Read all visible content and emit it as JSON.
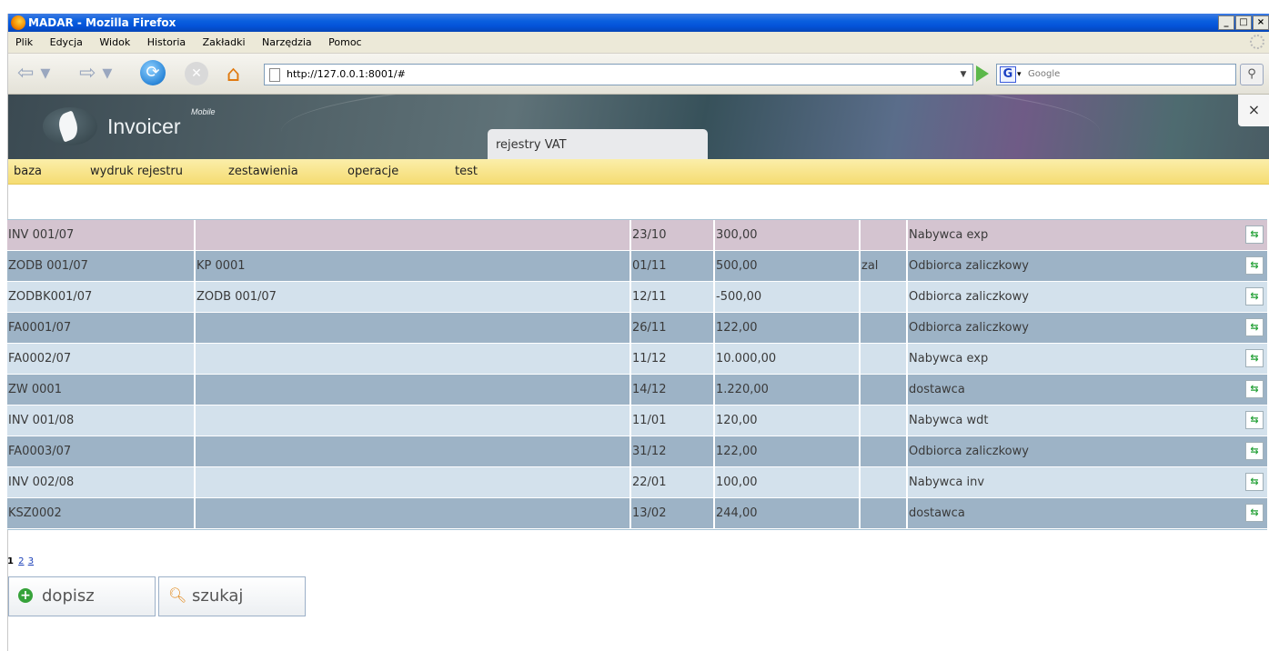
{
  "window": {
    "title": "MADAR - Mozilla Firefox",
    "controls": [
      "_",
      "□",
      "×"
    ]
  },
  "menubar": {
    "items": [
      "Plik",
      "Edycja",
      "Widok",
      "Historia",
      "Zakładki",
      "Narzędzia",
      "Pomoc"
    ]
  },
  "navbar": {
    "url": "http://127.0.0.1:8001/#",
    "search_placeholder": "Google"
  },
  "app": {
    "logo": "Invoicer",
    "logo_sup": "Mobile",
    "tab": "rejestry VAT",
    "close": "×",
    "menu": [
      "baza",
      "wydruk rejestru",
      "zestawienia",
      "operacje",
      "test"
    ]
  },
  "grid": {
    "rows": [
      {
        "doc": "INV 001/07",
        "ref": "",
        "date": "23/10",
        "amount": "300,00",
        "flag": "",
        "party": "Nabywca exp"
      },
      {
        "doc": "ZODB 001/07",
        "ref": "KP 0001",
        "date": "01/11",
        "amount": "500,00",
        "flag": "zal",
        "party": "Odbiorca zaliczkowy"
      },
      {
        "doc": "ZODBK001/07",
        "ref": "ZODB 001/07",
        "date": "12/11",
        "amount": "-500,00",
        "flag": "",
        "party": "Odbiorca zaliczkowy"
      },
      {
        "doc": "FA0001/07",
        "ref": "",
        "date": "26/11",
        "amount": "122,00",
        "flag": "",
        "party": "Odbiorca zaliczkowy"
      },
      {
        "doc": "FA0002/07",
        "ref": "",
        "date": "11/12",
        "amount": "10.000,00",
        "flag": "",
        "party": "Nabywca exp"
      },
      {
        "doc": "ZW 0001",
        "ref": "",
        "date": "14/12",
        "amount": "1.220,00",
        "flag": "",
        "party": "dostawca"
      },
      {
        "doc": "INV 001/08",
        "ref": "",
        "date": "11/01",
        "amount": "120,00",
        "flag": "",
        "party": "Nabywca wdt"
      },
      {
        "doc": "FA0003/07",
        "ref": "",
        "date": "31/12",
        "amount": "122,00",
        "flag": "",
        "party": "Odbiorca zaliczkowy"
      },
      {
        "doc": "INV 002/08",
        "ref": "",
        "date": "22/01",
        "amount": "100,00",
        "flag": "",
        "party": "Nabywca inv"
      },
      {
        "doc": "KSZ0002",
        "ref": "",
        "date": "13/02",
        "amount": "244,00",
        "flag": "",
        "party": "dostawca"
      }
    ]
  },
  "pager": {
    "current": "1",
    "pages": [
      "2",
      "3"
    ]
  },
  "buttons": {
    "add": "dopisz",
    "search": "szukaj"
  }
}
